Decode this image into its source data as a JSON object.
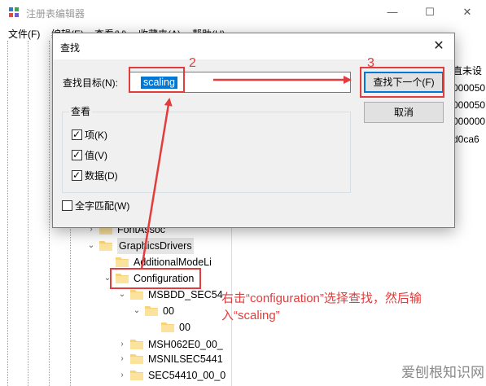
{
  "window": {
    "title": "注册表编辑器",
    "minimize": "—",
    "maximize": "☐",
    "close": "✕"
  },
  "menu": [
    {
      "label": "文件(F)"
    },
    {
      "label": "编辑(E)"
    },
    {
      "label": "查看(V)"
    },
    {
      "label": "收藏夹(A)"
    },
    {
      "label": "帮助(H)"
    }
  ],
  "tree": {
    "rows": [
      {
        "label": "FontAssoc",
        "chevron": "›",
        "selected": false
      },
      {
        "label": "GraphicsDrivers",
        "chevron": "⌄",
        "selected": true
      },
      {
        "label": "AdditionalModeLi",
        "chevron": "",
        "selected": false
      },
      {
        "label": "Configuration",
        "chevron": "⌄",
        "selected": false
      },
      {
        "label": "MSBDD_SEC54",
        "chevron": "⌄",
        "selected": false
      },
      {
        "label": "00",
        "chevron": "⌄",
        "selected": false
      },
      {
        "label": "00",
        "chevron": "",
        "selected": false
      },
      {
        "label": "MSH062E0_00_",
        "chevron": "›",
        "selected": false
      },
      {
        "label": "MSNILSEC5441",
        "chevron": "›",
        "selected": false
      },
      {
        "label": "SEC54410_00_0",
        "chevron": "›",
        "selected": false
      }
    ]
  },
  "values_column": {
    "header": "直未设",
    "cells": [
      "000050",
      "000050",
      "000000",
      "d0ca6"
    ]
  },
  "find_dialog": {
    "title": "查找",
    "close": "✕",
    "find_what_label": "查找目标(N):",
    "find_what_value": "scaling",
    "find_next_button": "查找下一个(F)",
    "cancel_button": "取消",
    "look_at_title": "查看",
    "options": [
      {
        "label": "项(K)",
        "checked": true
      },
      {
        "label": "值(V)",
        "checked": true
      },
      {
        "label": "数据(D)",
        "checked": true
      }
    ],
    "match_whole": {
      "label": "全字匹配(W)",
      "checked": false
    }
  },
  "annotations": {
    "step2": "2",
    "step3": "3",
    "caption": "右击“configuration”选择查找，然后输入“scaling”",
    "accent_color": "#e23c3c"
  },
  "watermark": "爱刨根知识网"
}
